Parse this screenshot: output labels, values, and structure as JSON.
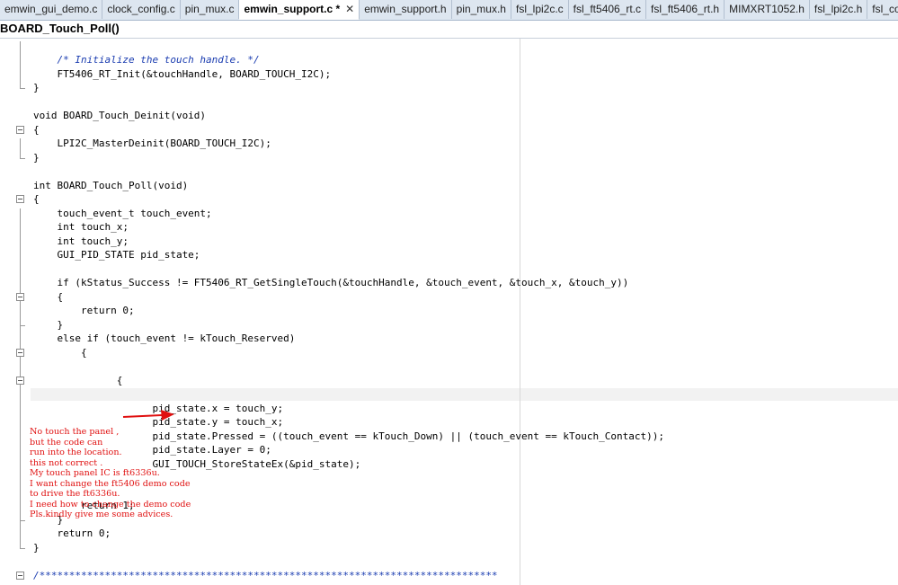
{
  "tabs": [
    {
      "label": "emwin_gui_demo.c",
      "active": false
    },
    {
      "label": "clock_config.c",
      "active": false
    },
    {
      "label": "pin_mux.c",
      "active": false
    },
    {
      "label": "emwin_support.c *",
      "active": true
    },
    {
      "label": "emwin_support.h",
      "active": false
    },
    {
      "label": "pin_mux.h",
      "active": false
    },
    {
      "label": "fsl_lpi2c.c",
      "active": false
    },
    {
      "label": "fsl_ft5406_rt.c",
      "active": false
    },
    {
      "label": "fsl_ft5406_rt.h",
      "active": false
    },
    {
      "label": "MIMXRT1052.h",
      "active": false
    },
    {
      "label": "fsl_lpi2c.h",
      "active": false
    },
    {
      "label": "fsl_common.h",
      "active": false
    }
  ],
  "close_glyph": "✕",
  "function_bar": {
    "name": "BOARD_Touch_Poll()"
  },
  "code_lines": [
    "    /* Initialize the touch handle. */",
    "    FT5406_RT_Init(&touchHandle, BOARD_TOUCH_I2C);",
    "}",
    "",
    "void BOARD_Touch_Deinit(void)",
    "{",
    "    LPI2C_MasterDeinit(BOARD_TOUCH_I2C);",
    "}",
    "",
    "int BOARD_Touch_Poll(void)",
    "{",
    "    touch_event_t touch_event;",
    "    int touch_x;",
    "    int touch_y;",
    "    GUI_PID_STATE pid_state;",
    "",
    "    if (kStatus_Success != FT5406_RT_GetSingleTouch(&touchHandle, &touch_event, &touch_x, &touch_y))",
    "    {",
    "        return 0;",
    "    }",
    "    else if (touch_event != kTouch_Reserved)",
    "        {",
    "",
    "              {",
    "",
    "                    pid_state.x = touch_y;",
    "                    pid_state.y = touch_x;",
    "                    pid_state.Pressed = ((touch_event == kTouch_Down) || (touch_event == kTouch_Contact));",
    "                    pid_state.Layer = 0;",
    "                    GUI_TOUCH_StoreStateEx(&pid_state);",
    "",
    "",
    "        return 1;",
    "    }",
    "    return 0;",
    "}",
    "",
    "/*****************************************************************************"
  ],
  "annotation_lines": [
    "No touch the panel ,",
    "but the code can",
    "run into the location.",
    "this not correct .",
    "My touch panel IC is ft6336u.",
    "I want change the ft5406 demo code",
    "to drive the ft6336u.",
    "I need how to change the demo code",
    "Pls.kindly give me some advices."
  ],
  "colors": {
    "comment": "#1a3cb0",
    "annotation": "#e01010",
    "arrow": "#e01010",
    "tabbar": "#dde6f0"
  }
}
